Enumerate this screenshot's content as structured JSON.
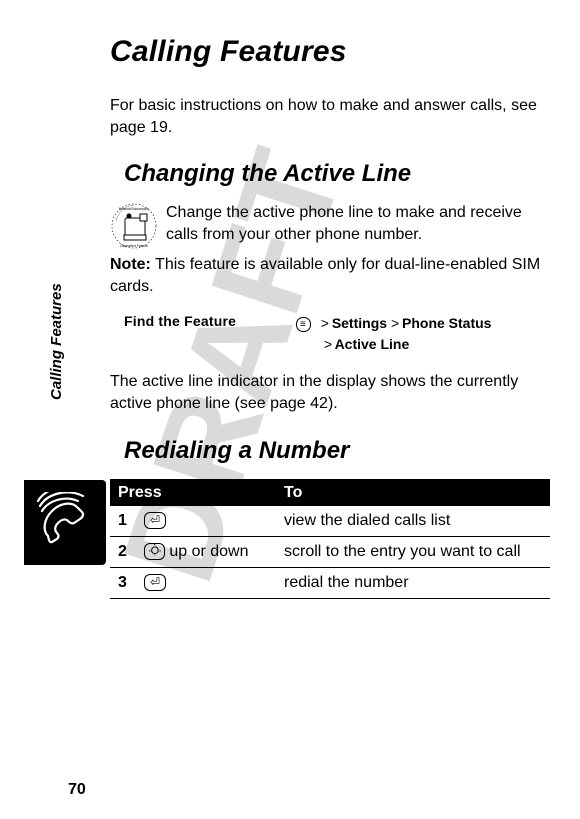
{
  "page_number": "70",
  "side_label": "Calling Features",
  "title": "Calling Features",
  "intro": "For basic instructions on how to make and answer calls, see page 19.",
  "section1": {
    "heading": "Changing the Active Line",
    "p1": "Change the active phone line to make and receive calls from your other phone number.",
    "note_label": "Note:",
    "note_text": " This feature is available only for dual-line-enabled SIM cards.",
    "find_feature_label": "Find the Feature",
    "menu_key_glyph": "≡",
    "path_l1_gt1": ">",
    "path_l1_a": "Settings",
    "path_l1_gt2": ">",
    "path_l1_b": "Phone Status",
    "path_l2_gt": ">",
    "path_l2_a": "Active Line",
    "after": "The active line indicator in the display shows the currently active phone line (see page 42)."
  },
  "section2": {
    "heading": "Redialing a Number",
    "table": {
      "head_press": "Press",
      "head_to": "To",
      "rows": [
        {
          "n": "1",
          "press_key": "O",
          "press_extra": "",
          "to": "view the dialed calls list"
        },
        {
          "n": "2",
          "press_key": "nav",
          "press_extra": " up or down",
          "to": "scroll to the entry you want to call"
        },
        {
          "n": "3",
          "press_key": "O",
          "press_extra": "",
          "to": "redial the number"
        }
      ]
    }
  },
  "icons": {
    "phone_tab": "phone-handset-icon",
    "network_sub": "network-subscription-dependent-feature-icon"
  }
}
